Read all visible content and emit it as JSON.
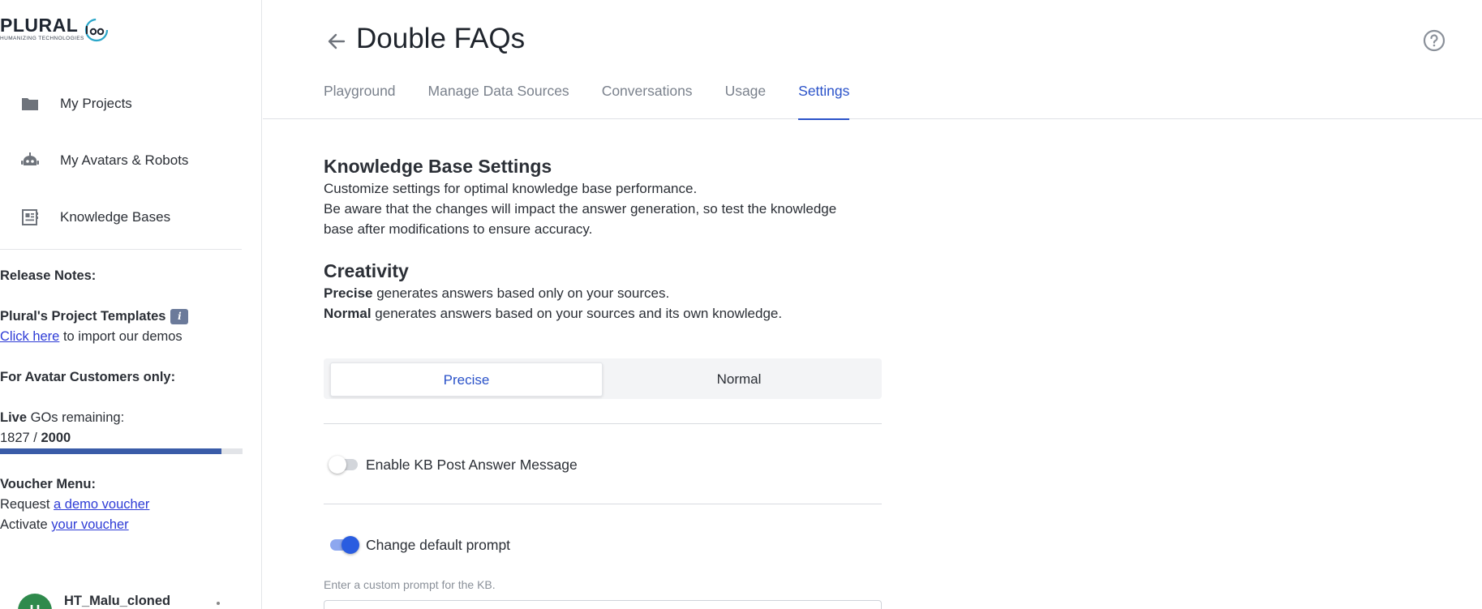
{
  "brand": {
    "name": "PLURAL",
    "tagline": "HUMANIZING TECHNOLOGIES"
  },
  "sidebar": {
    "items": [
      {
        "label": "My Projects",
        "icon": "folder-icon"
      },
      {
        "label": "My Avatars & Robots",
        "icon": "robot-icon"
      },
      {
        "label": "Knowledge Bases",
        "icon": "knowledge-base-icon"
      }
    ],
    "release_notes_title": "Release Notes:",
    "templates_title": "Plural's Project Templates",
    "info_badge": "i",
    "click_here": "Click here",
    "import_text": " to import our demos",
    "avatar_customers": "For Avatar Customers only:",
    "live_label": "Live",
    "gos_remaining": " GOs remaining:",
    "gos_used": "1827",
    "gos_sep": " / ",
    "gos_total": "2000",
    "gos_fraction": 0.9135,
    "voucher_title": "Voucher Menu:",
    "request_text": "Request ",
    "demo_voucher_link": "a demo voucher",
    "activate_text": "Activate ",
    "your_voucher_link": "your voucher",
    "user": {
      "initial": "H",
      "name": "HT_Malu_cloned"
    }
  },
  "header": {
    "title": "Double FAQs",
    "tabs": [
      {
        "label": "Playground"
      },
      {
        "label": "Manage Data Sources"
      },
      {
        "label": "Conversations"
      },
      {
        "label": "Usage"
      },
      {
        "label": "Settings",
        "active": true
      }
    ]
  },
  "settings": {
    "kb_title": "Knowledge Base Settings",
    "kb_desc_1": "Customize settings for optimal knowledge base performance.",
    "kb_desc_2": "Be aware that the changes will impact the answer generation, so test the knowledge",
    "kb_desc_3": "base after modifications to ensure accuracy.",
    "creativity_title": "Creativity",
    "precise_bold": "Precise",
    "precise_desc": " generates answers based only on your sources.",
    "normal_bold": "Normal",
    "normal_desc": " generates answers based on your sources and its own knowledge.",
    "segment": {
      "selected": "Precise",
      "other": "Normal"
    },
    "post_answer_label": "Enable KB Post Answer Message",
    "post_answer_enabled": false,
    "default_prompt_label": "Change default prompt",
    "default_prompt_enabled": true,
    "prompt_hint": "Enter a custom prompt for the KB."
  },
  "colors": {
    "accent": "#2a52c9",
    "progress": "#3a5ca8",
    "avatar": "#2f8a4c"
  }
}
